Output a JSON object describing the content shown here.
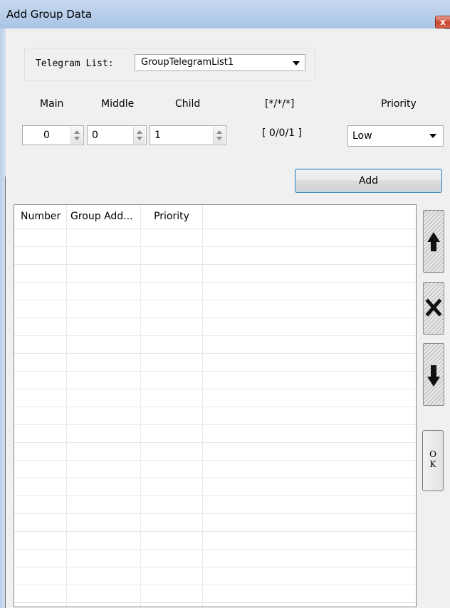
{
  "window": {
    "title": "Add Group Data",
    "close_glyph": "x"
  },
  "telegram": {
    "label": "Telegram List:",
    "selected": "GroupTelegramList1"
  },
  "address": {
    "main_label": "Main",
    "middle_label": "Middle",
    "child_label": "Child",
    "format_label": "[*/*/*]",
    "priority_label": "Priority",
    "main_value": "0",
    "middle_value": "0",
    "child_value": "1",
    "address_display": "[ 0/0/1 ]",
    "priority_value": "Low"
  },
  "add_button": "Add",
  "table": {
    "columns": [
      "Number",
      "Group Add...",
      "Priority"
    ],
    "rows": []
  },
  "side_buttons": {
    "up_icon": "arrow-up-icon",
    "delete_icon": "x-icon",
    "down_icon": "arrow-down-icon",
    "ok_label_1": "O",
    "ok_label_2": "K"
  }
}
